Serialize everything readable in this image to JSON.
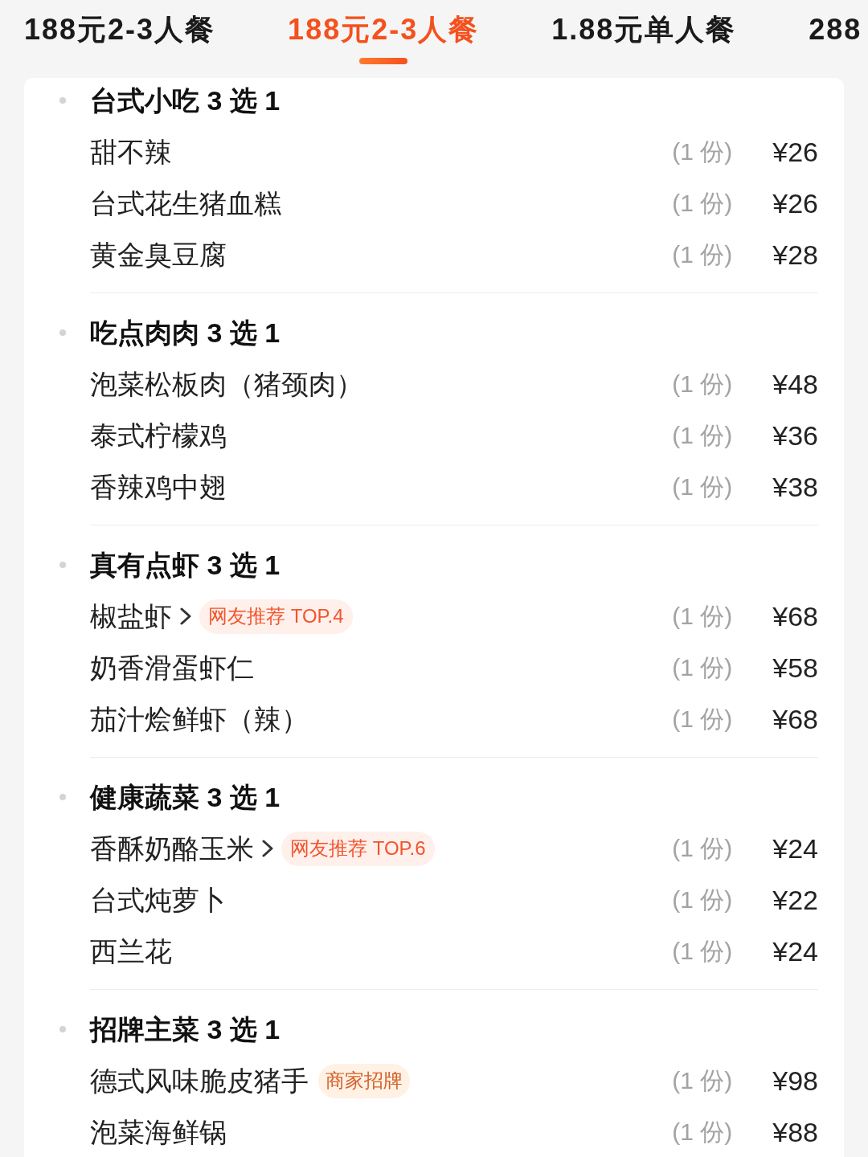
{
  "tabs": [
    {
      "label": "188元2-3人餐",
      "selected": false
    },
    {
      "label": "188元2-3人餐",
      "selected": true
    },
    {
      "label": "1.88元单人餐",
      "selected": false
    },
    {
      "label": "288",
      "selected": false
    }
  ],
  "groups": [
    {
      "title": "台式小吃 3 选 1",
      "items": [
        {
          "name": "甜不辣",
          "detail_link": false,
          "portion": "(1 份)",
          "price": "¥26"
        },
        {
          "name": "台式花生猪血糕",
          "detail_link": false,
          "portion": "(1 份)",
          "price": "¥26"
        },
        {
          "name": "黄金臭豆腐",
          "detail_link": false,
          "portion": "(1 份)",
          "price": "¥28"
        }
      ]
    },
    {
      "title": "吃点肉肉 3 选 1",
      "items": [
        {
          "name": "泡菜松板肉（猪颈肉）",
          "detail_link": false,
          "portion": "(1 份)",
          "price": "¥48"
        },
        {
          "name": "泰式柠檬鸡",
          "detail_link": false,
          "portion": "(1 份)",
          "price": "¥36"
        },
        {
          "name": "香辣鸡中翅",
          "detail_link": false,
          "portion": "(1 份)",
          "price": "¥38"
        }
      ]
    },
    {
      "title": "真有点虾 3 选 1",
      "items": [
        {
          "name": "椒盐虾",
          "detail_link": true,
          "badge": {
            "kind": "recommend",
            "text": "网友推荐 TOP.4"
          },
          "portion": "(1 份)",
          "price": "¥68"
        },
        {
          "name": "奶香滑蛋虾仁",
          "detail_link": false,
          "portion": "(1 份)",
          "price": "¥58"
        },
        {
          "name": "茄汁烩鲜虾（辣）",
          "detail_link": false,
          "portion": "(1 份)",
          "price": "¥68"
        }
      ]
    },
    {
      "title": "健康蔬菜 3 选 1",
      "items": [
        {
          "name": "香酥奶酪玉米",
          "detail_link": true,
          "badge": {
            "kind": "recommend",
            "text": "网友推荐 TOP.6"
          },
          "portion": "(1 份)",
          "price": "¥24"
        },
        {
          "name": "台式炖萝卜",
          "detail_link": false,
          "portion": "(1 份)",
          "price": "¥22"
        },
        {
          "name": "西兰花",
          "detail_link": false,
          "portion": "(1 份)",
          "price": "¥24"
        }
      ]
    },
    {
      "title": "招牌主菜 3 选 1",
      "items": [
        {
          "name": "德式风味脆皮猪手",
          "detail_link": false,
          "badge": {
            "kind": "signature",
            "text": "商家招牌"
          },
          "portion": "(1 份)",
          "price": "¥98"
        },
        {
          "name": "泡菜海鲜锅",
          "detail_link": false,
          "portion": "(1 份)",
          "price": "¥88"
        }
      ]
    }
  ]
}
